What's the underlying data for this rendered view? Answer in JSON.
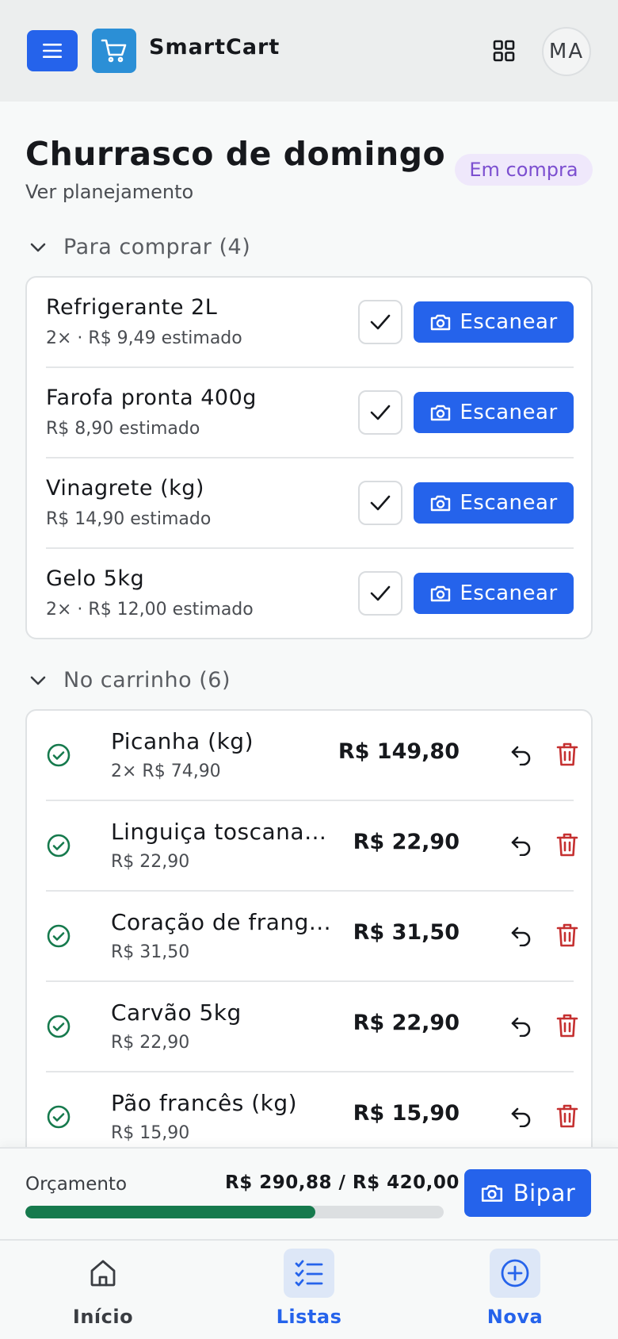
{
  "header": {
    "app_title": "SmartCart",
    "avatar_initials": "MA"
  },
  "list": {
    "title": "Churrasco de domingo",
    "planning_link": "Ver planejamento",
    "status": "Em compra"
  },
  "to_buy": {
    "heading": "Para comprar (4)",
    "scan_label": "Escanear",
    "items": [
      {
        "name": "Refrigerante 2L",
        "meta": "2× · R$ 9,49 estimado"
      },
      {
        "name": "Farofa pronta 400g",
        "meta": "R$ 8,90 estimado"
      },
      {
        "name": "Vinagrete (kg)",
        "meta": "R$ 14,90 estimado"
      },
      {
        "name": "Gelo 5kg",
        "meta": "2× · R$ 12,00 estimado"
      }
    ]
  },
  "in_cart": {
    "heading": "No carrinho (6)",
    "items": [
      {
        "name": "Picanha (kg)",
        "meta": "2× R$ 74,90",
        "total": "R$ 149,80"
      },
      {
        "name": "Linguiça toscana ...",
        "meta": "R$ 22,90",
        "total": "R$ 22,90"
      },
      {
        "name": "Coração de frang...",
        "meta": "R$ 31,50",
        "total": "R$ 31,50"
      },
      {
        "name": "Carvão 5kg",
        "meta": "R$ 22,90",
        "total": "R$ 22,90"
      },
      {
        "name": "Pão francês (kg)",
        "meta": "R$ 15,90",
        "total": "R$ 15,90"
      }
    ]
  },
  "budget": {
    "label": "Orçamento",
    "values": "R$ 290,88 / R$ 420,00",
    "progress_fraction": 0.6926,
    "scan_button": "Bipar"
  },
  "nav": {
    "items": [
      {
        "label": "Início",
        "icon": "home-icon",
        "active": false
      },
      {
        "label": "Listas",
        "icon": "checklist-icon",
        "active": true
      },
      {
        "label": "Nova",
        "icon": "plus-circle-icon",
        "active": true
      }
    ]
  },
  "colors": {
    "primary": "#2563eb",
    "success": "#167a4d",
    "danger": "#c53030",
    "badge_bg": "#efe8fb",
    "badge_text": "#7c4fd0"
  }
}
